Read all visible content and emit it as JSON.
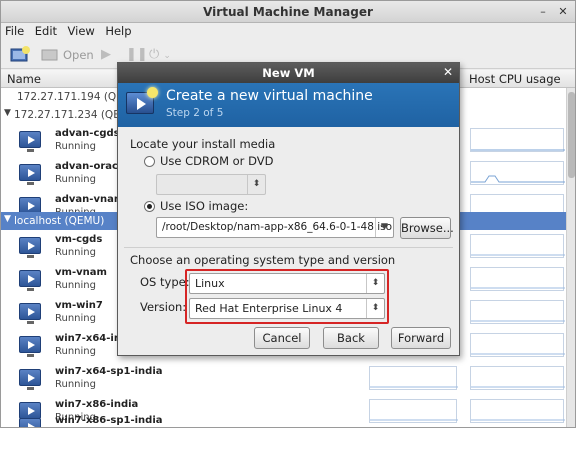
{
  "main_window": {
    "title": "Virtual Machine Manager",
    "menu": [
      "File",
      "Edit",
      "View",
      "Help"
    ],
    "toolbar": {
      "open_label": "Open"
    },
    "columns": {
      "name": "Name",
      "host_cpu": "Host CPU usage"
    }
  },
  "connections": [
    {
      "label": "172.27.171.194 (QEMU)",
      "expanded": false
    },
    {
      "label": "172.27.171.234 (QEMU)",
      "expanded": true
    },
    {
      "label": "localhost (QEMU)",
      "expanded": true,
      "selected": true
    }
  ],
  "vms": [
    {
      "name": "advan-cgds",
      "status": "Running"
    },
    {
      "name": "advan-oracle",
      "status": "Running"
    },
    {
      "name": "advan-vnam",
      "status": "Running"
    },
    {
      "name": "vm-cgds",
      "status": "Running"
    },
    {
      "name": "vm-vnam",
      "status": "Running"
    },
    {
      "name": "vm-win7",
      "status": "Running"
    },
    {
      "name": "win7-x64-india",
      "status": "Running"
    },
    {
      "name": "win7-x64-sp1-india",
      "status": "Running"
    },
    {
      "name": "win7-x86-india",
      "status": "Running"
    },
    {
      "name": "win7-x86-sp1-india",
      "status": ""
    }
  ],
  "dialog": {
    "title": "New VM",
    "banner_title": "Create a new virtual machine",
    "banner_step": "Step 2 of 5",
    "install_media_label": "Locate your install media",
    "cdrom_option": "Use CDROM or DVD",
    "iso_option": "Use ISO image:",
    "iso_path": "/root/Desktop/nam-app-x86_64.6-0-1-48.iso",
    "browse_button": "Browse...",
    "os_section_label": "Choose an operating system type and version",
    "os_type_label": "OS type:",
    "os_type_value": "Linux",
    "version_label": "Version:",
    "version_value": "Red Hat Enterprise Linux 4",
    "cancel_button": "Cancel",
    "back_button": "Back",
    "forward_button": "Forward",
    "selected_media": "iso"
  },
  "colors": {
    "banner_blue": "#2a74b7",
    "selection_blue": "#5782c7",
    "highlight_red": "#d62525"
  }
}
